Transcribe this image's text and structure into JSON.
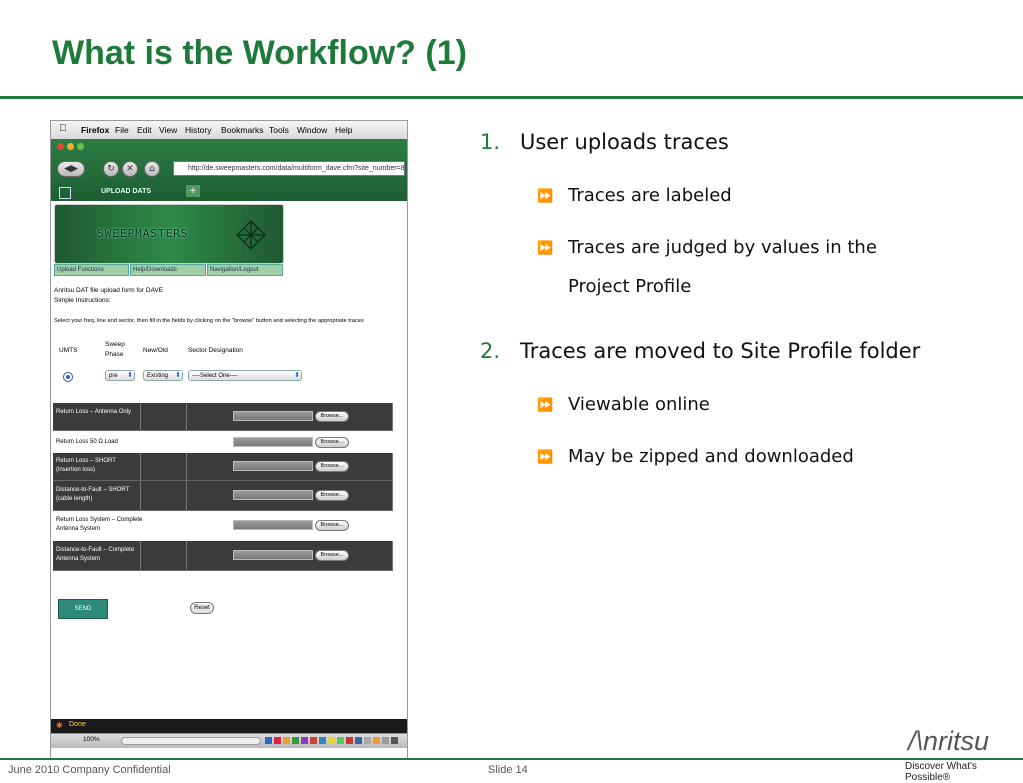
{
  "slide": {
    "title": "What is the Workflow? (1)",
    "footer_left": "June 2010 Company Confidential",
    "footer_center": "Slide 14",
    "logo_text": "/\\nritsu",
    "logo_tagline": "Discover What's Possible®"
  },
  "bullets": [
    {
      "number": "1.",
      "text": "User uploads traces",
      "subs": [
        "Traces are labeled",
        "Traces are judged by values in the",
        "Project Profile"
      ]
    },
    {
      "number": "2.",
      "text": "Traces are moved to Site Profile folder",
      "subs": [
        "Viewable online",
        "May be zipped and downloaded"
      ]
    }
  ],
  "screenshot": {
    "menubar": [
      "Firefox",
      "File",
      "Edit",
      "View",
      "History",
      "Bookmarks",
      "Tools",
      "Window",
      "Help"
    ],
    "url": "http://de.sweepmasters.com/data/multiform_dave.cfm?site_number=8",
    "tab_label": "UPLOAD DATS",
    "banner_text": "SWEEPMASTERS",
    "nav_tabs": [
      "Upload Functions",
      "Help/Downloads",
      "Navigation/Logout"
    ],
    "intro_lines": [
      "Anritsu DAT file upload form for DAVE",
      "Simple Instructions:",
      "Select your freq, line and sector, then fill in the fields by clicking on the \"browse\" button and selecting the appropriate traces"
    ],
    "columns": {
      "col1": "UMTS",
      "col2a": "Sweep",
      "col2b": "Phase",
      "col3": "New/Old",
      "col4": "Sector Designation"
    },
    "selects": {
      "phase": "pre",
      "new_old": "Existing",
      "sector": "----Select One----"
    },
    "traces": [
      {
        "label": "Return Loss – Antenna Only",
        "browse": "Browse..."
      },
      {
        "label": "Return Loss 50 Ω Load",
        "browse": "Browse..."
      },
      {
        "label": "Return Loss – SHORT (insertion loss)",
        "browse": "Browse..."
      },
      {
        "label": "Distance-to-Fault – SHORT (cable length)",
        "browse": "Browse..."
      },
      {
        "label": "Return Loss System – Complete Antenna System",
        "browse": "Browse..."
      },
      {
        "label": "Distance-to-Fault – Complete Antenna System",
        "browse": "Browse..."
      }
    ],
    "send": "SEND",
    "reset": "Reset",
    "status": "Done",
    "zoom": "100%"
  }
}
